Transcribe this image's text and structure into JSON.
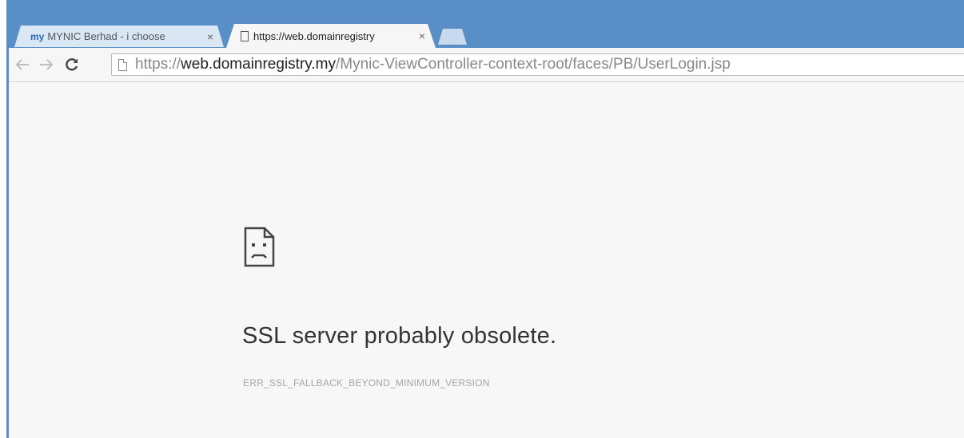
{
  "tabs": [
    {
      "favicon_text": "my",
      "title": "MYNIC Berhad - i choose",
      "close": "×",
      "active": false
    },
    {
      "title": "https://web.domainregistry",
      "close": "×",
      "active": true
    }
  ],
  "toolbar": {
    "back_glyph": "⇐",
    "forward_glyph": "⇒",
    "reload_glyph": "C",
    "url_scheme": "https://",
    "url_host": "web.domainregistry.my",
    "url_path": "/Mynic-ViewController-context-root/faces/PB/UserLogin.jsp"
  },
  "error": {
    "icon": "sad-document-icon",
    "title": "SSL server probably obsolete.",
    "code": "ERR_SSL_FALLBACK_BEYOND_MINIMUM_VERSION"
  },
  "colors": {
    "frame": "#5a8ec6",
    "content_bg": "#f7f7f7",
    "title_text": "#333333",
    "code_text": "#a6a6a6"
  }
}
